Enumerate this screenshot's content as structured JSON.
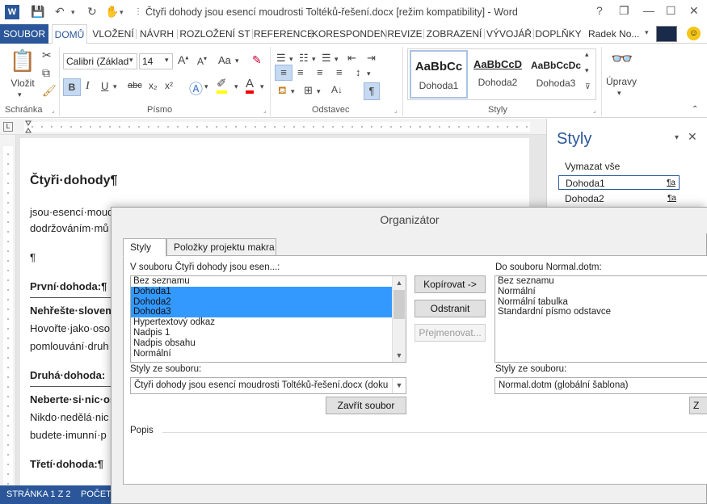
{
  "window": {
    "title": "Čtyři dohody jsou esencí moudrosti Toltéků-řešení.docx [režim kompatibility] - Word",
    "help": "?",
    "restore": "❐",
    "minimize": "—",
    "maximize": "☐",
    "close": "✕"
  },
  "tabs": [
    "SOUBOR",
    "DOMŮ",
    "VLOŽENÍ",
    "NÁVRH",
    "ROZLOŽENÍ ST",
    "REFERENCE",
    "KORESPONDEN",
    "REVIZE",
    "ZOBRAZENÍ",
    "VÝVOJÁŘ",
    "DOPLŇKY"
  ],
  "user": "Radek No...",
  "ribbon": {
    "paste_label": "Vložit",
    "font_name": "Calibri (Základ",
    "font_size": "14",
    "case_label": "Aa",
    "groups": {
      "clipboard": "Schránka",
      "font": "Písmo",
      "paragraph": "Odstavec",
      "styles": "Styly",
      "editing": "Úpravy"
    },
    "style_gallery": [
      {
        "preview": "AaBbCc",
        "name": "Dohoda1"
      },
      {
        "preview": "AaBbCcD",
        "name": "Dohoda2"
      },
      {
        "preview": "AaBbCcDc",
        "name": "Dohoda3"
      }
    ],
    "bold": "B",
    "italic": "I",
    "underline": "U",
    "strike": "abc",
    "sub": "x₂",
    "sup": "x²"
  },
  "document": {
    "lines": [
      "Čtyři·dohody¶",
      "jsou·esencí·moud",
      "dodržováním·mů",
      "¶",
      "První·dohoda:¶",
      "Nehřešte·slovem",
      "Hovořte·jako·oso",
      "pomlouvání·druh",
      "Druhá·dohoda:",
      "Neberte·si·nic·os",
      "Nikdo·nedělá·nic",
      "budete·imunní·p",
      "Třetí·dohoda:¶"
    ]
  },
  "styles_pane": {
    "title": "Styly",
    "clear_all": "Vymazat vše",
    "items": [
      {
        "name": "Dohoda1",
        "mark": "¶a"
      },
      {
        "name": "Dohoda2",
        "mark": "¶a"
      }
    ]
  },
  "status": {
    "page": "STRÁNKA 1 Z 2",
    "count": "POČET"
  },
  "dialog": {
    "title": "Organizátor",
    "tabs": [
      "Styly",
      "Položky projektu makra"
    ],
    "left_label": "V souboru Čtyři dohody jsou esen...:",
    "left_items": [
      "Bez seznamu",
      "Dohoda1",
      "Dohoda2",
      "Dohoda3",
      "Hypertextový odkaz",
      "Nadpis 1",
      "Nadpis obsahu",
      "Normální"
    ],
    "left_selected": [
      1,
      2,
      3
    ],
    "right_label": "Do souboru Normal.dotm:",
    "right_items": [
      "Bez seznamu",
      "Normální",
      "Normální tabulka",
      "Standardní písmo odstavce"
    ],
    "buttons": {
      "copy": "Kopírovat ->",
      "delete": "Odstranit",
      "rename": "Přejmenovat...",
      "close_left": "Zavřít soubor",
      "close_right": "Z"
    },
    "left_source_label": "Styly ze souboru:",
    "left_source_value": "Čtyři dohody jsou esencí moudrosti Toltéků-řešení.docx (doku",
    "right_source_label": "Styly ze souboru:",
    "right_source_value": "Normal.dotm (globální šablona)",
    "description_label": "Popis"
  },
  "colors": {
    "accent": "#2b579a",
    "selection": "#3399ff"
  }
}
